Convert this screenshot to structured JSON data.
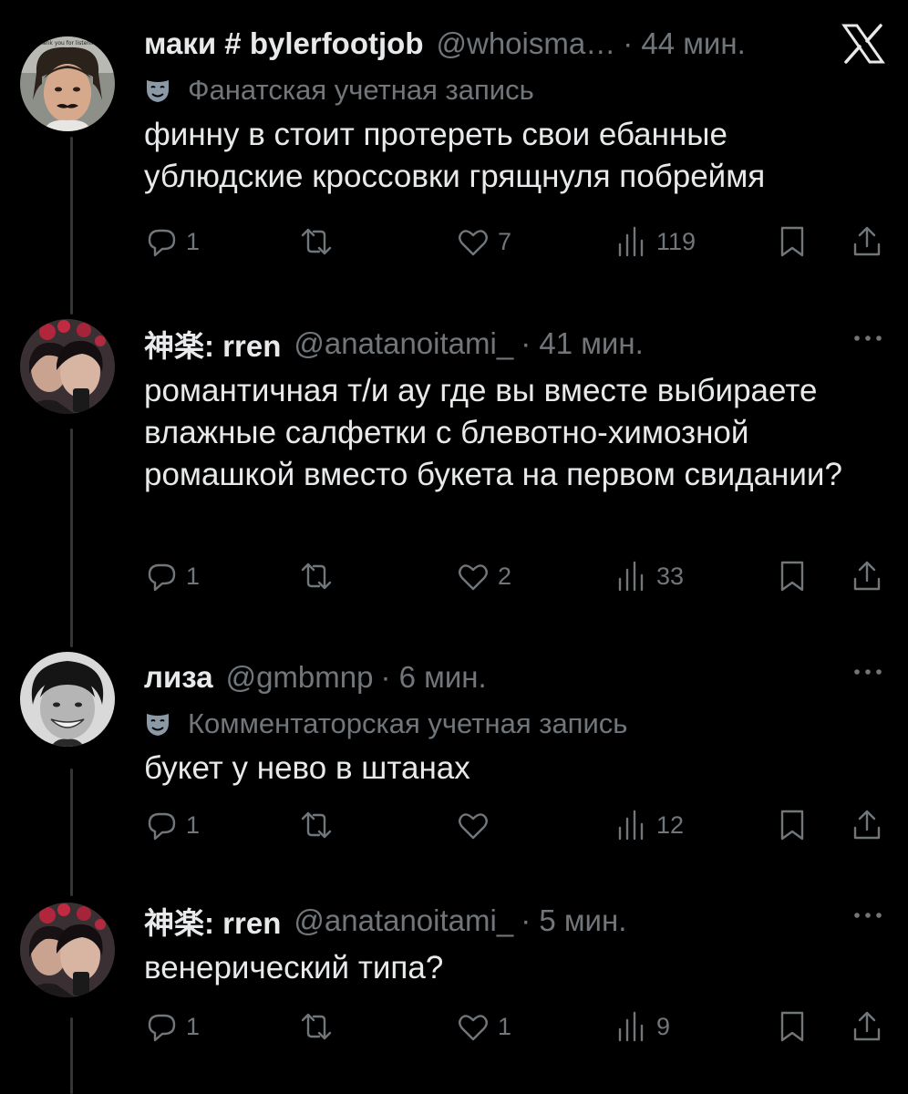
{
  "tweets": [
    {
      "name": "маки # bylerfootjob",
      "handle": "@whoisma…",
      "time": "· 44 мин.",
      "label": "Фанатская учетная запись",
      "text": "финну в стоит протереть свои ебанные ублюдские кроссовки грящнуля побреймя",
      "replies": "1",
      "reposts": "",
      "likes": "7",
      "views": "119",
      "avatar_caption": "Thank you for listening"
    },
    {
      "name": "神楽: rren",
      "handle": "@anatanoitami_",
      "time": "· 41 мин.",
      "label": "",
      "text": "романтичная т/и ау где вы вместе выбираете влажные салфетки с блевотно-химозной ромашкой вместо букета на первом свидании?",
      "replies": "1",
      "reposts": "",
      "likes": "2",
      "views": "33"
    },
    {
      "name": "лиза",
      "handle": "@gmbmnp",
      "time": "· 6 мин.",
      "label": "Комментаторская учетная запись",
      "text": "букет у нево в штанах",
      "replies": "1",
      "reposts": "",
      "likes": "",
      "views": "12"
    },
    {
      "name": "神楽: rren",
      "handle": "@anatanoitami_",
      "time": "· 5 мин.",
      "label": "",
      "text": "венерический типа?",
      "replies": "1",
      "reposts": "",
      "likes": "1",
      "views": "9"
    }
  ],
  "icons": {
    "reply": "reply-icon",
    "repost": "repost-icon",
    "like": "like-icon",
    "views": "views-icon",
    "bookmark": "bookmark-icon",
    "share": "share-icon",
    "more": "more-icon",
    "brand": "x-logo-icon",
    "label": "mask-icon"
  },
  "colors": {
    "background": "#000000",
    "text": "#e7e9ea",
    "muted": "#71767b",
    "line": "#333639"
  }
}
